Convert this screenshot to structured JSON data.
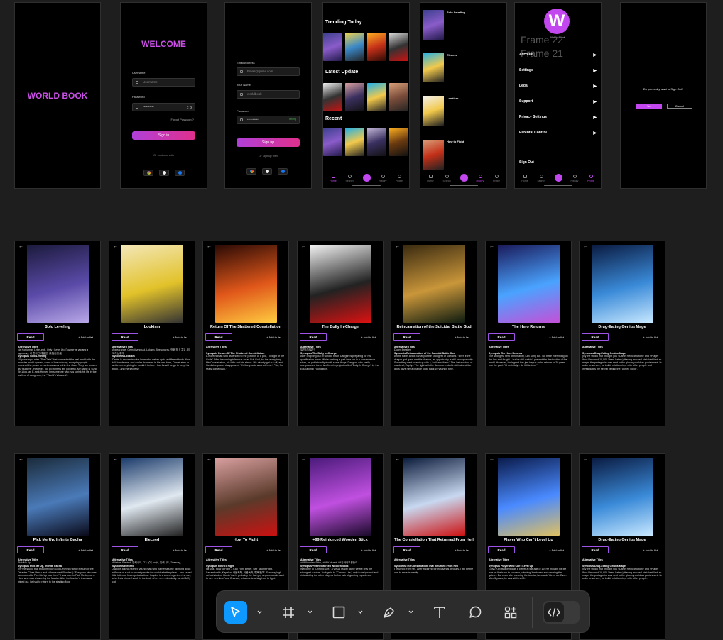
{
  "splash": {
    "logo": "WORLD BOOK"
  },
  "login": {
    "title": "WELCOME",
    "username_label": "Username",
    "username_placeholder": "Username",
    "password_label": "Password",
    "password_value": "••••••••••",
    "forgot": "Forgot Password?",
    "submit": "Sign in",
    "divider": "Or continue with"
  },
  "signup": {
    "email_label": "Email Address",
    "email_value": "Email@gmail.com",
    "name_label": "Your Name",
    "name_value": "worldbook",
    "password_label": "Password",
    "password_value": "••••••••••",
    "strength": "Strong",
    "submit": "Sign up",
    "divider": "Or sign up with"
  },
  "home": {
    "trending_title": "Trending Today",
    "latest_title": "Latest Update",
    "recent_title": "Recent"
  },
  "tabs": [
    "Home",
    "Search",
    "History",
    "Profile"
  ],
  "history": {
    "items": [
      "Solo Leveling",
      "Eleceed",
      "Lookism",
      "How to Fight"
    ]
  },
  "profile": {
    "avatar_letter": "W",
    "name": "World Book",
    "overlay_a": "Frame 22",
    "overlay_b": "Frame 21",
    "menu": [
      "Account",
      "Settings",
      "Legal",
      "Support",
      "Privacy Settings",
      "Parental Control"
    ],
    "signout": "Sign Out"
  },
  "signout_dialog": {
    "question": "Do you really want to Sign Out?",
    "yes": "Yes",
    "cancel": "Cancel"
  },
  "detail_common": {
    "read": "Read",
    "add": "+ Add to list",
    "alt_label": "Alternative Titles"
  },
  "details_row1": [
    {
      "title": "Solo Leveling",
      "syn": "Synopsis Solo Leveling",
      "alt": "Na Honjaman Lebel-eob, Only I Level Up, Поднятие уровня в одиночку, 나 혼자만 레벨업, 我独自升级",
      "body": "10 years ago, after \"The Gate\" that connected the real world with the monster world opened, some of the ordinary, everyday people received the power to hunt monsters within the Gate. They are known as \"Hunters\". However, not all Hunters are powerful. My name is Sung Jin-Woo, an E-rank Hunter. I'm someone who has to risk his life in the lowliest of dungeons, the \"World's Weakest\"."
    },
    {
      "title": "Lookism",
      "syn": "Synopsis Lookism",
      "alt": "Appearance, Oemojisangjuui, Lukizm, Внешность, 外貌至上主义, 외모지상주의",
      "body": "Daniel is an unattractive loner who wakes up to a different body. Now tall, handsome, and cooler than ever in his new form, Daniel aims to achieve everything he couldn't before. How far will he go to keep his body... and the secrets?"
    },
    {
      "title": "Return Of The Shattered Constellation",
      "syn": "Synopsis Return Of The Shattered Constellation",
      "alt": "",
      "body": "A more human who ascended to the position of a god, \"Twilight of the Gods\". After becoming infamous as an Evil God, he lost everything. His Constellation, his faith and his status. His divinity got cut off, and his divine power disappeared. \"I'd like you to work with me.\" \"So, I've really come back.\""
    },
    {
      "title": "The Bully In-Charge",
      "syn": "Synopsis The Bully In-Charge",
      "alt": "일진담당일진",
      "body": "After dropping out of school, Kwon Daegun is preparing for his qualification exam. While working a part-time job in a convenience store, he got into a fight with some thugs. Daegun, who easily overpowered them, is offered a project called \"Bully In Charge\" by the Educational Foundation."
    },
    {
      "title": "Reincarnation of the Suicidal Battle God",
      "syn": "Synopsis Reincarnation of the Suicidal Battle God",
      "alt": "Doom Breaker",
      "body": "A time travel action fantasy of the strongest of Mankind. \"Even if the dragon god gave me this chance, an opportunity is still an opportunity. Since they want to end up with it, I will end them.\" The last survivor of mankind, Zephyr. The fight with the demons ended in defeat and the gods gave him a chance to go back 10 years in time."
    },
    {
      "title": "The Hero Returns",
      "syn": "Synopsis The Hero Returns",
      "alt": "",
      "body": "The strongest hero of humanity, Kim Sung Bin. No three everything on the line and fought... but he still couldn't prevent the destruction of the world. However, his legend has just begun as he returns to 20 years into the past. \"I'll definitely... do it this time.\""
    },
    {
      "title": "Drug-Eating Genius Mage",
      "syn": "Synopsis Drug-Eating Genius Mage",
      "alt": "",
      "body": "(By the studio that brought you <Damn Reincarnation> and <Player Who Returned 10,000 Years Later>) Having reached his talent limit as mage, the protagonist was sent to the gloomy world as punishment. In order to survive, he builds relationships with other people and investigates the secret behind the \"closed world\"."
    }
  ],
  "details_row2": [
    {
      "title": "Pick Me Up, Infinite Gacha",
      "syn": "Synopsis Pick Me Up, Infinite Gacha",
      "alt": "Pick Me Up",
      "body": "(By the studio that brought you <Solo Leveling> and <Return of the Disaster-Class Hero> and <Omniscient Reader>) \"Everyone who was summoned to Pick Me Up is a Hero.\" I was born in Pick Me Up, as a Hero who was chosen by the Master. After the Master's team was wiped out, he had to return to the starting floor."
    },
    {
      "title": "Eleceed",
      "syn": "Synopsis Eleceed",
      "alt": "Ailiixide, Elected, 일렉시드, エレクシード, 일렉시드, Элексид",
      "body": "Jiwoo is a kind-hearted young man who harnesses the lightning quick reflexes of a cat to secretly make the world a better place – one saved little kitten or foster pet at a time. Kayden is a secret agent on the run, who finds himself stuck in the body of a... um... decidedly fat old fluffy cat."
    },
    {
      "title": "How To Fight",
      "syn": "Synopsis How To Fight",
      "alt": "",
      "body": "Hit viral, How to Fight – Can Fight Better, Self Taught Fight, Sasamdoekk, Kapalka, 싸움독학, 싸움독학, 喧嘩独学. Scrawny high school student Hobin Yoo is probably the last guy anyone would want to see in a NewTube Channel, let alone teaching how to fight."
    },
    {
      "title": "+99 Reinforced Wooden Stick",
      "syn": "Synopsis +99 Reinforced Wooden Stick",
      "alt": "+99 Wooden Stick, +99 Kobushi, 99강화나무몽둥이",
      "body": "Welcome to \"Chronic Life,\" a virtual reality game where only the strongest survive. Jiu logs in to \"Chronic Life,\" only to be ignored and ridiculed by the other players for his lack of gaming experience."
    },
    {
      "title": "The Constellation That Returned From Hell",
      "syn": "Synopsis The Constellation That Returned From Hell",
      "alt": "",
      "body": "I returned from hell. After enduring for thousands of years, I will be the one to save humanity."
    },
    {
      "title": "Player Who Can't Level Up",
      "syn": "Synopsis Player Who Can't Level Up",
      "alt": "",
      "body": "Gigyu Kim awakened as a player at the age of 19. He thought his life was on the track to success, climbing 'the tower' and clearing the gates... But even after clearing the tutorial, he couldn't level up. Even after 5 years, he was still level 1."
    },
    {
      "title": "Drug-Eating Genius Mage",
      "syn": "Synopsis Drug-Eating Genius Mage",
      "alt": "",
      "body": "(By the studio that brought you <Damn Reincarnation> and <Player Who Returned 10,000 Years Later>) Having reached his talent limit as mage, the protagonist was sent to the gloomy world as punishment. In order to survive, he builds relationships with other people."
    }
  ],
  "toolbar": {
    "accent": "#0d99ff",
    "tools": [
      "move-tool",
      "frame-tool",
      "shape-tool",
      "pen-tool",
      "text-tool",
      "comment-tool",
      "actions-tool",
      "dev-mode-toggle"
    ]
  }
}
